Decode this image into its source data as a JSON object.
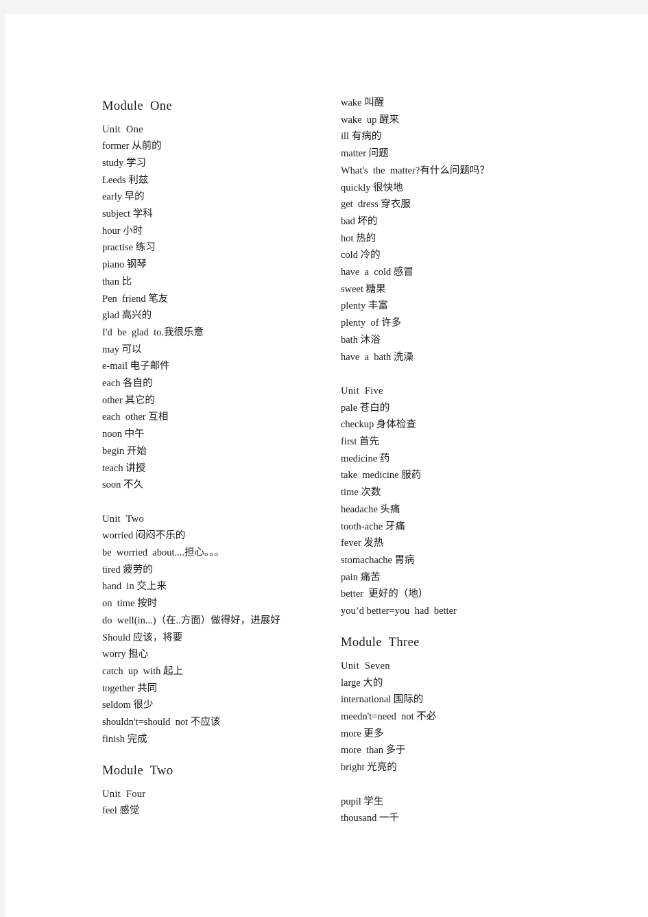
{
  "document": {
    "type": "vocabulary-word-list",
    "page_background": "#f4f4f4",
    "paper_background": "#ffffff",
    "text_color": "#1a1a1a"
  },
  "left_column": {
    "blocks": [
      {
        "kind": "module",
        "title": "Module  One"
      },
      {
        "kind": "unit",
        "heading": "Unit  One",
        "entries": [
          "former 从前的",
          "study 学习",
          "Leeds 利兹",
          "early 早的",
          "subject 学科",
          "hour 小时",
          "practise 练习",
          "piano 钢琴",
          "than 比",
          "Pen  friend 笔友",
          "glad 高兴的",
          "I'd  be  glad  to.我很乐意",
          "may 可以",
          "e-mail 电子邮件",
          "each 各自的",
          "other 其它的",
          "each  other 互相",
          "noon 中午",
          "begin 开始",
          "teach 讲授",
          "soon 不久"
        ]
      },
      {
        "kind": "unit",
        "heading": "Unit  Two",
        "entries": [
          "worried 闷闷不乐的",
          "be  worried  about....担心。。。",
          "tired 疲劳的",
          "hand  in 交上来",
          "on  time 按时",
          "do  well(in...)（在..方面）做得好，进展好",
          "Should 应该，将要",
          "worry 担心",
          "catch  up  with 起上",
          "together 共同",
          "seldom 很少",
          "shouldn't=should  not 不应该",
          "finish 完成"
        ]
      },
      {
        "kind": "module",
        "title": "Module  Two"
      },
      {
        "kind": "unit",
        "heading": "Unit  Four",
        "entries": [
          "feel 感觉"
        ]
      }
    ]
  },
  "right_column": {
    "blocks": [
      {
        "kind": "continuation",
        "heading": "",
        "entries": [
          "wake 叫醒",
          "wake  up 醒来",
          "ill 有病的",
          "matter 问题",
          "What's  the  matter?有什么问题吗？",
          "quickly 很快地",
          "get  dress 穿衣服",
          "bad 坏的",
          "hot 热的",
          "cold 冷的",
          "have  a  cold 感冒",
          "sweet 糖果",
          "plenty 丰富",
          "plenty  of 许多",
          "bath 沐浴",
          "have  a  bath 洗澡"
        ]
      },
      {
        "kind": "unit",
        "heading": "Unit  Five",
        "entries": [
          "pale 苍白的",
          "checkup 身体检查",
          "first 首先",
          "medicine 药",
          "take  medicine 服药",
          "time 次数",
          "headache 头痛",
          "tooth-ache 牙痛",
          "fever 发热",
          "stomachache 胃病",
          "pain 痛苦",
          "better  更好的（地）",
          "you’d better=you  had  better"
        ]
      },
      {
        "kind": "module",
        "title": "Module  Three"
      },
      {
        "kind": "unit",
        "heading": "Unit  Seven",
        "entries": [
          "large 大的",
          "international 国际的",
          "meedn't=need  not 不必",
          "more 更多",
          "more  than 多于",
          "bright 光亮的"
        ]
      },
      {
        "kind": "continuation",
        "heading": "",
        "entries": [
          "pupil 学生",
          "thousand 一千"
        ]
      }
    ]
  }
}
